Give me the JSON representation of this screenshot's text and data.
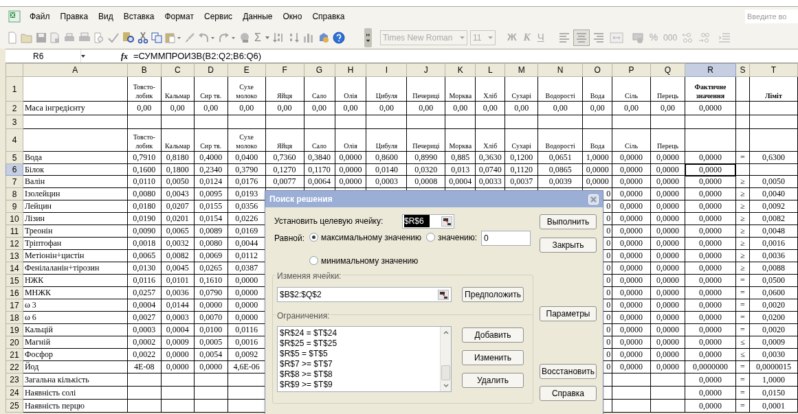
{
  "menu": [
    "Файл",
    "Правка",
    "Вид",
    "Вставка",
    "Формат",
    "Сервис",
    "Данные",
    "Окно",
    "Справка"
  ],
  "help_search": {
    "placeholder": "Введите во"
  },
  "toolbar": {
    "autosum": "Σ",
    "font": "Times New Roman",
    "size": "11",
    "bold": "Ж",
    "italic": "К",
    "underline": "Ч",
    "percent": "%",
    "thousands": "000",
    "alignment": [
      {
        "selected": false
      },
      {
        "selected": true
      },
      {
        "selected": false
      }
    ]
  },
  "formula_bar": {
    "name_box": "R6",
    "fx": "fx",
    "formula": "=СУММПРОИЗВ(B2:Q2;B6:Q6)"
  },
  "sheet": {
    "columns": [
      {
        "letter": "A",
        "selected": false
      },
      {
        "letter": "B",
        "selected": false
      },
      {
        "letter": "C",
        "selected": false
      },
      {
        "letter": "D",
        "selected": false
      },
      {
        "letter": "E",
        "selected": false
      },
      {
        "letter": "F",
        "selected": false
      },
      {
        "letter": "G",
        "selected": false
      },
      {
        "letter": "H",
        "selected": false
      },
      {
        "letter": "I",
        "selected": false
      },
      {
        "letter": "J",
        "selected": false
      },
      {
        "letter": "K",
        "selected": false
      },
      {
        "letter": "L",
        "selected": false
      },
      {
        "letter": "M",
        "selected": false
      },
      {
        "letter": "N",
        "selected": false
      },
      {
        "letter": "O",
        "selected": false
      },
      {
        "letter": "P",
        "selected": false
      },
      {
        "letter": "Q",
        "selected": false
      },
      {
        "letter": "R",
        "selected": true
      },
      {
        "letter": "S",
        "selected": false
      },
      {
        "letter": "T",
        "selected": false
      }
    ],
    "rows": [
      {
        "number": "1",
        "selected": false,
        "cells": {
          "B": "Товсто-\nлобик",
          "C": "Кальмар",
          "D": "Сир тв.",
          "E": "Сухе\nмолоко",
          "F": "Яйця",
          "G": "Сало",
          "H": "Олія",
          "I": "Цибуля",
          "J": "Печериці",
          "K": "Морква",
          "L": "Хліб",
          "M": "Сухарі",
          "N": "Водорості",
          "O": "Вода",
          "P": "Сіль",
          "Q": "Перець",
          "R": {
            "text": "Фактичне\nзначення",
            "bold": true
          },
          "T": {
            "text": "Ліміт",
            "bold": true
          }
        }
      },
      {
        "number": "2",
        "selected": false,
        "cells": {
          "A": "Маса інгредієнту",
          "B": "0,00",
          "C": "0,00",
          "D": "0,00",
          "E": "0,00",
          "F": "0,00",
          "G": "0,00",
          "H": "0,00",
          "I": "0,00",
          "J": "0,00",
          "K": "0,00",
          "L": "0,00",
          "M": "0,00",
          "N": "0,00",
          "O": "0,00",
          "P": "0,00",
          "Q": "0,00",
          "R": "0,0000"
        }
      },
      {
        "number": "3",
        "selected": false,
        "cells": {}
      },
      {
        "number": "4",
        "selected": false,
        "cells": {
          "B": "Товсто-\nлобик",
          "C": "Кальмар",
          "D": "Сир тв.",
          "E": "Сухе\nмолоко",
          "F": "Яйця",
          "G": "Сало",
          "H": "Олія",
          "I": "Цибуля",
          "J": "Печериці",
          "K": "Морква",
          "L": "Хліб",
          "M": "Сухарі",
          "N": "Водорості",
          "O": "Вода",
          "P": "Сіль",
          "Q": "Перець"
        }
      },
      {
        "number": "5",
        "selected": false,
        "cells": {
          "A": "Вода",
          "B": "0,7910",
          "C": "0,8180",
          "D": "0,4000",
          "E": "0,0400",
          "F": "0,7360",
          "G": "0,3840",
          "H": "0,0000",
          "I": "0,8600",
          "J": "0,8990",
          "K": "0,885",
          "L": "0,3630",
          "M": "0,1200",
          "N": "0,0651",
          "O": "1,0000",
          "P": "0,0000",
          "Q": "0,0000",
          "R": "0,0000",
          "S": "=",
          "T": "0,6300"
        }
      },
      {
        "number": "6",
        "selected": true,
        "cells": {
          "A": "Білок",
          "B": "0,1600",
          "C": "0,1800",
          "D": "0,2340",
          "E": "0,3790",
          "F": "0,1270",
          "G": "0,1170",
          "H": "0,0000",
          "I": "0,0140",
          "J": "0,0320",
          "K": "0,013",
          "L": "0,0740",
          "M": "0,1120",
          "N": "0,0865",
          "O": "0,0000",
          "P": "0,0000",
          "Q": "0,0000",
          "R": "0,0000"
        }
      },
      {
        "number": "7",
        "selected": false,
        "cells": {
          "A": "Валін",
          "B": "0,0110",
          "C": "0,0050",
          "D": "0,0124",
          "E": "0,0176",
          "F": "0,0077",
          "G": "0,0064",
          "H": "0,0000",
          "I": "0,0003",
          "J": "0,0008",
          "K": "0,0004",
          "L": "0,0033",
          "M": "0,0037",
          "N": "0,0039",
          "O": "0,0000",
          "P": "0,0000",
          "Q": "0,0000",
          "R": "0,0000",
          "S": "≥",
          "T": "0,0050"
        }
      },
      {
        "number": "8",
        "selected": false,
        "cells": {
          "A": "Ізолейцин",
          "B": "0,0080",
          "C": "0,0043",
          "D": "0,0095",
          "E": "0,0193",
          "O": "0",
          "P": "0,0000",
          "Q": "0,0000",
          "R": "0,0000",
          "S": "≥",
          "T": "0,0040"
        }
      },
      {
        "number": "9",
        "selected": false,
        "cells": {
          "A": "Лейцин",
          "B": "0,0180",
          "C": "0,0207",
          "D": "0,0155",
          "E": "0,0356",
          "O": "0",
          "P": "0,0000",
          "Q": "0,0000",
          "R": "0,0000",
          "S": "≥",
          "T": "0,0092"
        }
      },
      {
        "number": "10",
        "selected": false,
        "cells": {
          "A": "Лізин",
          "B": "0,0190",
          "C": "0,0201",
          "D": "0,0154",
          "E": "0,0226",
          "O": "0",
          "P": "0,0000",
          "Q": "0,0000",
          "R": "0,0000",
          "S": "≥",
          "T": "0,0082"
        }
      },
      {
        "number": "11",
        "selected": false,
        "cells": {
          "A": "Треонін",
          "B": "0,0090",
          "C": "0,0065",
          "D": "0,0089",
          "E": "0,0169",
          "O": "0",
          "P": "0,0000",
          "Q": "0,0000",
          "R": "0,0000",
          "S": "≥",
          "T": "0,0048"
        }
      },
      {
        "number": "12",
        "selected": false,
        "cells": {
          "A": "Тріптофан",
          "B": "0,0018",
          "C": "0,0032",
          "D": "0,0080",
          "E": "0,0044",
          "O": "0",
          "P": "0,0000",
          "Q": "0,0000",
          "R": "0,0000",
          "S": "≥",
          "T": "0,0016"
        }
      },
      {
        "number": "13",
        "selected": false,
        "cells": {
          "A": "Метіонін+цистін",
          "B": "0,0065",
          "C": "0,0082",
          "D": "0,0069",
          "E": "0,0112",
          "O": "0",
          "P": "0,0000",
          "Q": "0,0000",
          "R": "0,0000",
          "S": "≥",
          "T": "0,0036"
        }
      },
      {
        "number": "14",
        "selected": false,
        "cells": {
          "A": "Фенілаланін+тірозин",
          "B": "0,0130",
          "C": "0,0045",
          "D": "0,0265",
          "E": "0,0387",
          "O": "0",
          "P": "0,0000",
          "Q": "0,0000",
          "R": "0,0000",
          "S": "≥",
          "T": "0,0088"
        }
      },
      {
        "number": "15",
        "selected": false,
        "cells": {
          "A": "НЖК",
          "B": "0,0116",
          "C": "0,0101",
          "D": "0,1610",
          "E": "0,0000",
          "O": "0",
          "P": "0,0000",
          "Q": "0,0000",
          "R": "0,0000",
          "S": "=",
          "T": "0,0500"
        }
      },
      {
        "number": "16",
        "selected": false,
        "cells": {
          "A": "МНЖК",
          "B": "0,0257",
          "C": "0,0036",
          "D": "0,0790",
          "E": "0,0000",
          "O": "0",
          "P": "0,0000",
          "Q": "0,0000",
          "R": "0,0000",
          "S": "=",
          "T": "0,0600"
        }
      },
      {
        "number": "17",
        "selected": false,
        "cells": {
          "A": "ω 3",
          "B": "0,0004",
          "C": "0,0144",
          "D": "0,0000",
          "E": "0,0000",
          "O": "0",
          "P": "0,0000",
          "Q": "0,0000",
          "R": "0,0000",
          "S": "=",
          "T": "0,0020"
        }
      },
      {
        "number": "18",
        "selected": false,
        "cells": {
          "A": "ω 6",
          "B": "0,0027",
          "C": "0,0003",
          "D": "0,0070",
          "E": "0,0000",
          "O": "0",
          "P": "0,0000",
          "Q": "0,0000",
          "R": "0,0000",
          "S": "=",
          "T": "0,0200"
        }
      },
      {
        "number": "19",
        "selected": false,
        "cells": {
          "A": "Кальцій",
          "B": "0,0003",
          "C": "0,0004",
          "D": "0,0100",
          "E": "0,0116",
          "O": "0",
          "P": "0,0000",
          "Q": "0,0000",
          "R": "0,0000",
          "S": "=",
          "T": "0,0020"
        }
      },
      {
        "number": "20",
        "selected": false,
        "cells": {
          "A": "Магній",
          "B": "0,0002",
          "C": "0,0009",
          "D": "0,0005",
          "E": "0,0016",
          "O": "0",
          "P": "0,0000",
          "Q": "0,0000",
          "R": "0,0000",
          "S": "≤",
          "T": "0,0009"
        }
      },
      {
        "number": "21",
        "selected": false,
        "cells": {
          "A": "Фосфор",
          "B": "0,0022",
          "C": "0,0000",
          "D": "0,0054",
          "E": "0,0092",
          "O": "0",
          "P": "0,0000",
          "Q": "0,0000",
          "R": "0,0000",
          "S": "≤",
          "T": "0,0030"
        }
      },
      {
        "number": "22",
        "selected": false,
        "cells": {
          "A": "Йод",
          "B": "4E-08",
          "C": "0,0000",
          "D": "0,0000",
          "E": "4,6E-06",
          "O": "0",
          "P": "0,0000",
          "Q": "0,0000",
          "R": "0,0000000",
          "S": "=",
          "T": "0,0000015"
        }
      },
      {
        "number": "23",
        "selected": false,
        "cells": {
          "A": "Загальна кількість",
          "R": "0,0000",
          "S": "=",
          "T": "1,0000"
        }
      },
      {
        "number": "24",
        "selected": false,
        "cells": {
          "A": "Наявність солі",
          "R": "0,0000",
          "S": "=",
          "T": "0,0150"
        }
      },
      {
        "number": "25",
        "selected": false,
        "cells": {
          "A": "Наявність перцю",
          "R": "0,0000",
          "S": "=",
          "T": "0,0001"
        }
      }
    ]
  },
  "dialog": {
    "title": "Поиск решения",
    "target_label": "Установить целевую ячейку:",
    "target_value": "$R$6",
    "equal_label": "Равной:",
    "options": [
      {
        "label": "максимальному значению",
        "selected": true
      },
      {
        "label": "значению:",
        "selected": false
      },
      {
        "label": "минимальному значению",
        "selected": false
      }
    ],
    "value": "0",
    "changing_label": "Изменяя ячейки:",
    "changing_value": "$B$2:$Q$2",
    "guess_button": "Предположить",
    "constraints_label": "Ограничения:",
    "constraints": [
      "$R$24 = $T$24",
      "$R$25 = $T$25",
      "$R$5 = $T$5",
      "$R$7 >= $T$7",
      "$R$8 >= $T$8",
      "$R$9 >= $T$9"
    ],
    "constraint_buttons": [
      "Добавить",
      "Изменить",
      "Удалить"
    ],
    "side_buttons": [
      "Выполнить",
      "Закрыть",
      "Параметры",
      "Восстановить",
      "Справка"
    ]
  }
}
